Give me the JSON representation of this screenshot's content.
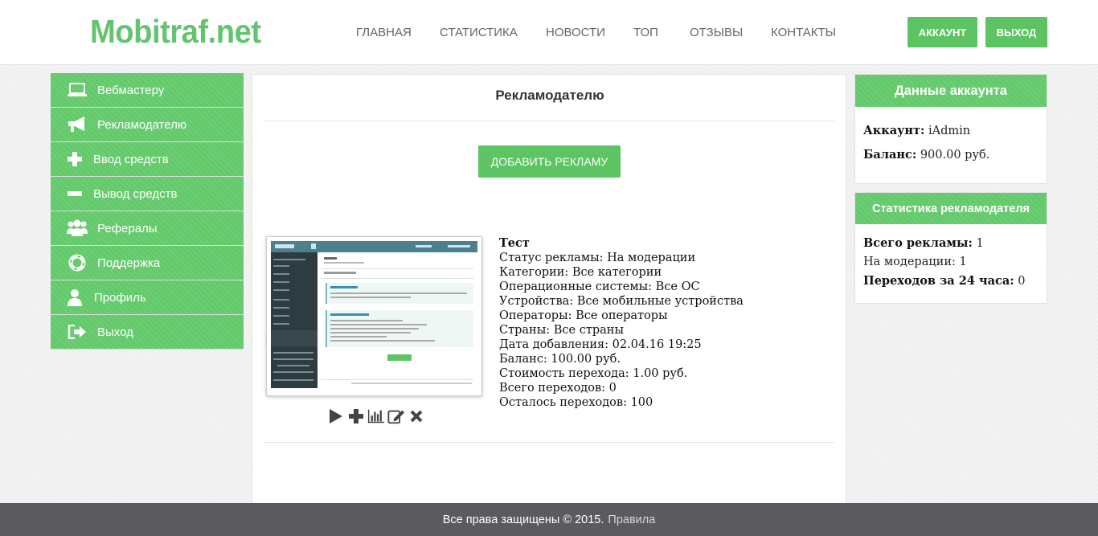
{
  "brand": {
    "logo": "Mobitraf.net"
  },
  "nav": {
    "items": [
      {
        "label": "ГЛАВНАЯ"
      },
      {
        "label": "СТАТИСТИКА"
      },
      {
        "label": "НОВОСТИ"
      },
      {
        "label": "ТОП"
      },
      {
        "label": "ОТЗЫВЫ"
      },
      {
        "label": "КОНТАКТЫ"
      }
    ],
    "account_button": "АККАУНТ",
    "logout_button": "ВЫХОД"
  },
  "sidebar": {
    "items": [
      {
        "label": "Вебмастеру",
        "icon": "laptop-icon"
      },
      {
        "label": "Рекламодателю",
        "icon": "megaphone-icon"
      },
      {
        "label": "Ввод средств",
        "icon": "plus-icon"
      },
      {
        "label": "Вывод средств",
        "icon": "minus-icon"
      },
      {
        "label": "Рефералы",
        "icon": "users-icon"
      },
      {
        "label": "Поддержка",
        "icon": "lifebuoy-icon"
      },
      {
        "label": "Профиль",
        "icon": "user-icon"
      },
      {
        "label": "Выход",
        "icon": "sign-out-icon"
      }
    ]
  },
  "main": {
    "title": "Рекламодателю",
    "add_button": "ДОБАВИТЬ РЕКЛАМУ",
    "ad": {
      "name": "Тест",
      "status": "Статус рекламы: На модерации",
      "categories": "Категории: Все категории",
      "os": "Операционные системы: Все ОС",
      "devices": "Устройства: Все мобильные устройства",
      "operators": "Операторы: Все операторы",
      "countries": "Страны: Все страны",
      "date_added": "Дата добавления: 02.04.16 19:25",
      "balance": "Баланс: 100.00 руб.",
      "click_cost": "Стоимость перехода: 1.00 руб.",
      "total_clicks": "Всего переходов: 0",
      "clicks_left": "Осталось переходов: 100",
      "actions": [
        "play-icon",
        "plus-icon",
        "bar-chart-icon",
        "edit-icon",
        "close-icon"
      ]
    }
  },
  "account_panel": {
    "title": "Данные аккаунта",
    "account_label": "Аккаунт:",
    "account_value": "iAdmin",
    "balance_label": "Баланс:",
    "balance_value": "900.00 руб."
  },
  "stats_panel": {
    "title": "Статистика рекламодателя",
    "total_label": "Всего рекламы:",
    "total_value": "1",
    "moderation_label": "На модерации:",
    "moderation_value": "1",
    "clicks24_label": "Переходов за 24 часа:",
    "clicks24_value": "0"
  },
  "footer": {
    "copyright": "Все права защищены © 2015.",
    "rules_link": "Правила"
  },
  "colors": {
    "accent": "#5cc462",
    "footer_bg": "#5b5b5f"
  }
}
